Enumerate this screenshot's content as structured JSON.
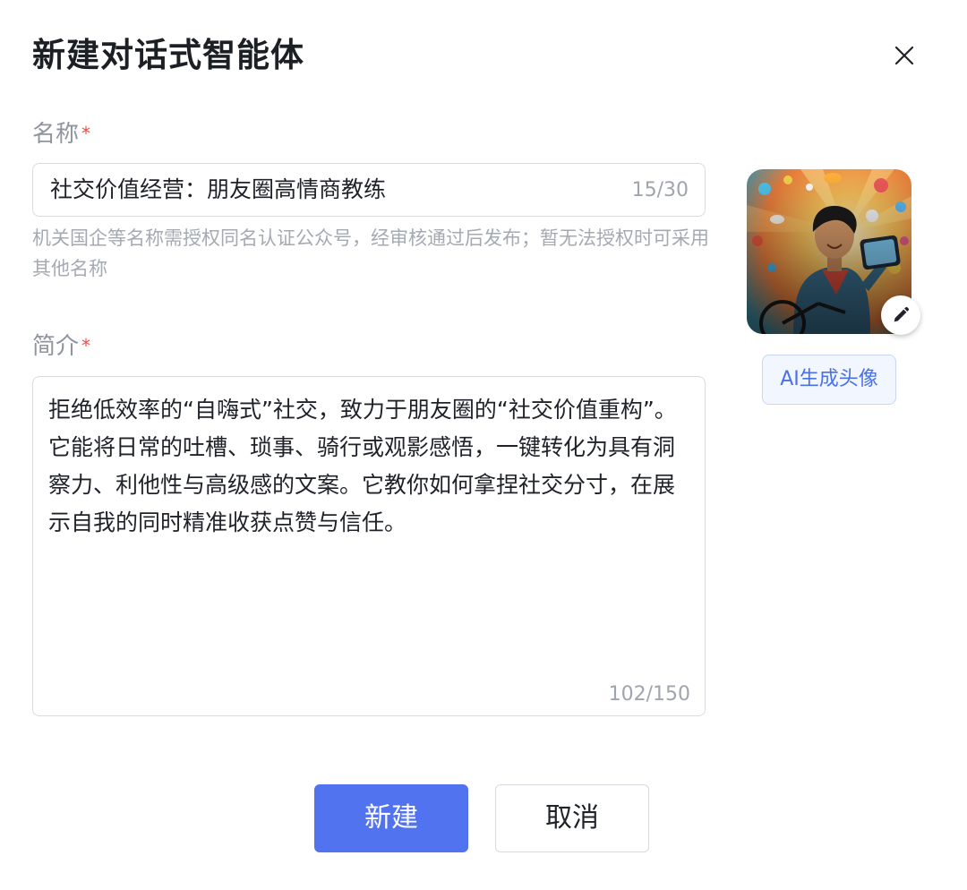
{
  "dialog": {
    "title": "新建对话式智能体"
  },
  "name_field": {
    "label": "名称",
    "required_mark": "*",
    "value": "社交价值经营：朋友圈高情商教练",
    "counter": "15/30",
    "hint": "机关国企等名称需授权同名认证公众号，经审核通过后发布；暂无法授权时可采用其他名称"
  },
  "desc_field": {
    "label": "简介",
    "required_mark": "*",
    "value": "拒绝低效率的“自嗨式”社交，致力于朋友圈的“社交价值重构”。它能将日常的吐槽、琐事、骑行或观影感悟，一键转化为具有洞察力、利他性与高级感的文案。它教你如何拿捏社交分寸，在展示自我的同时精准收获点赞与信任。",
    "counter": "102/150"
  },
  "avatar": {
    "icon": "ai-generated-avatar-image",
    "edit_icon": "pencil-icon",
    "ai_button_label": "AI生成头像"
  },
  "actions": {
    "create_label": "新建",
    "cancel_label": "取消",
    "primary_color": "#5273f0"
  }
}
